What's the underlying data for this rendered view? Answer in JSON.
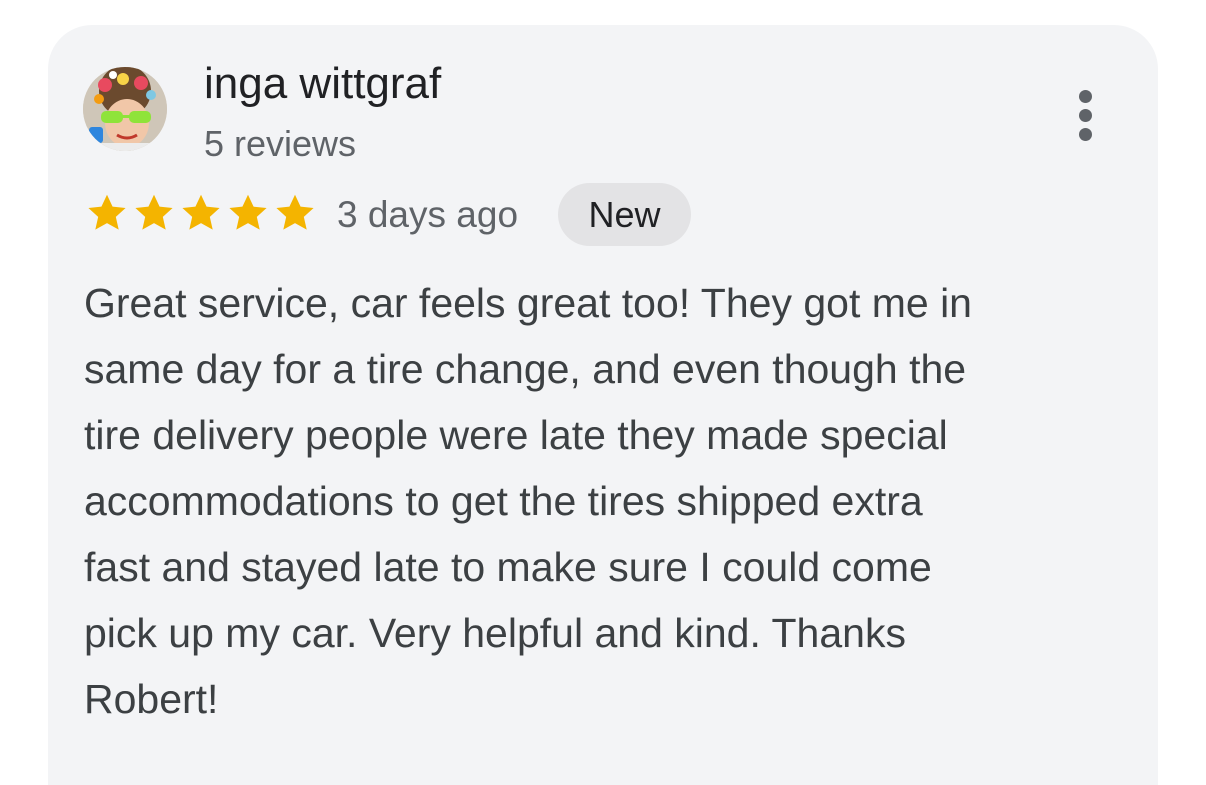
{
  "review": {
    "author": {
      "name": "inga wittgraf",
      "reviews_count": "5 reviews",
      "avatar_icon": "user-avatar-photo"
    },
    "rating": 5,
    "rating_max": 5,
    "time_ago": "3 days ago",
    "badge": "New",
    "text": "Great service, car feels great too! They got me in\nsame day for a tire change, and even though the\ntire delivery people were late they made special\naccommodations to get the tires shipped extra\nfast and stayed late to make sure I could come\npick up my car. Very helpful and kind. Thanks\nRobert!",
    "more_options_icon": "more-vert-icon"
  },
  "colors": {
    "card_background": "#f3f4f6",
    "star": "#f4b400",
    "badge_background": "#e3e3e5",
    "primary_text": "#202124",
    "secondary_text": "#5f6368"
  }
}
